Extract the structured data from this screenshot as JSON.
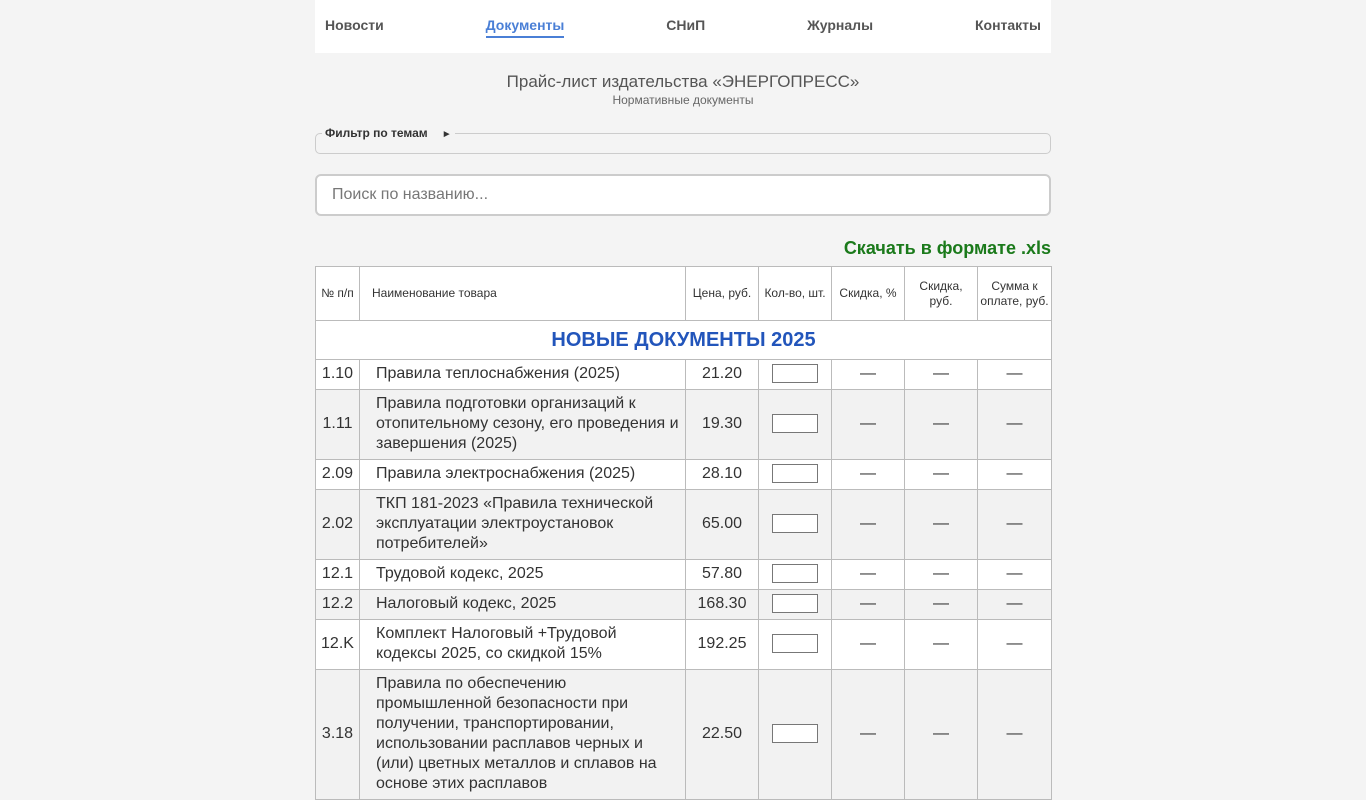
{
  "nav": {
    "items": [
      {
        "label": "Новости"
      },
      {
        "label": "Документы"
      },
      {
        "label": "СНиП"
      },
      {
        "label": "Журналы"
      },
      {
        "label": "Контакты"
      }
    ]
  },
  "page": {
    "title": "Прайс-лист издательства «ЭНЕРГОПРЕСС»",
    "subtitle": "Нормативные документы"
  },
  "filter": {
    "label": "Фильтр по темам",
    "toggle_icon": "triangle-right-icon",
    "toggle_glyph": "►"
  },
  "search": {
    "placeholder": "Поиск по названию..."
  },
  "download": {
    "label": "Скачать в формате .xls",
    "color": "#1b7a1b"
  },
  "accent_color": "#4a7fd6",
  "section_color": "#2255bb",
  "table": {
    "headers": {
      "num": "№ п/п",
      "name": "Наименование товара",
      "price": "Цена, руб.",
      "qty": "Кол-во, шт.",
      "discount_pct": "Скидка, %",
      "discount_rub": "Скидка, руб.",
      "total": "Сумма к оплате, руб."
    },
    "section_title": "НОВЫЕ ДОКУМЕНТЫ 2025",
    "rows": [
      {
        "num": "1.10",
        "name": "Правила теплоснабжения (2025)",
        "price": "21.20",
        "d_pct": "—",
        "d_rub": "—",
        "total": "—"
      },
      {
        "num": "1.11",
        "name": "Правила подготовки организаций к отопительному сезону, его проведения и завершения (2025)",
        "price": "19.30",
        "d_pct": "—",
        "d_rub": "—",
        "total": "—"
      },
      {
        "num": "2.09",
        "name": "Правила электроснабжения (2025)",
        "price": "28.10",
        "d_pct": "—",
        "d_rub": "—",
        "total": "—"
      },
      {
        "num": "2.02",
        "name": "ТКП 181-2023 «Правила технической эксплуатации электроустановок потребителей»",
        "price": "65.00",
        "d_pct": "—",
        "d_rub": "—",
        "total": "—"
      },
      {
        "num": "12.1",
        "name": "Трудовой кодекс, 2025",
        "price": "57.80",
        "d_pct": "—",
        "d_rub": "—",
        "total": "—"
      },
      {
        "num": "12.2",
        "name": "Налоговый кодекс, 2025",
        "price": "168.30",
        "d_pct": "—",
        "d_rub": "—",
        "total": "—"
      },
      {
        "num": "12.K",
        "name": "Комплект Налоговый +Трудовой кодексы 2025, со скидкой 15%",
        "price": "192.25",
        "d_pct": "—",
        "d_rub": "—",
        "total": "—"
      },
      {
        "num": "3.18",
        "name": "Правила по обеспечению промышленной безопасности при получении, транспортировании, использовании расплавов черных и (или) цветных металлов и сплавов на основе этих расплавов",
        "price": "22.50",
        "d_pct": "—",
        "d_rub": "—",
        "total": "—"
      }
    ]
  }
}
